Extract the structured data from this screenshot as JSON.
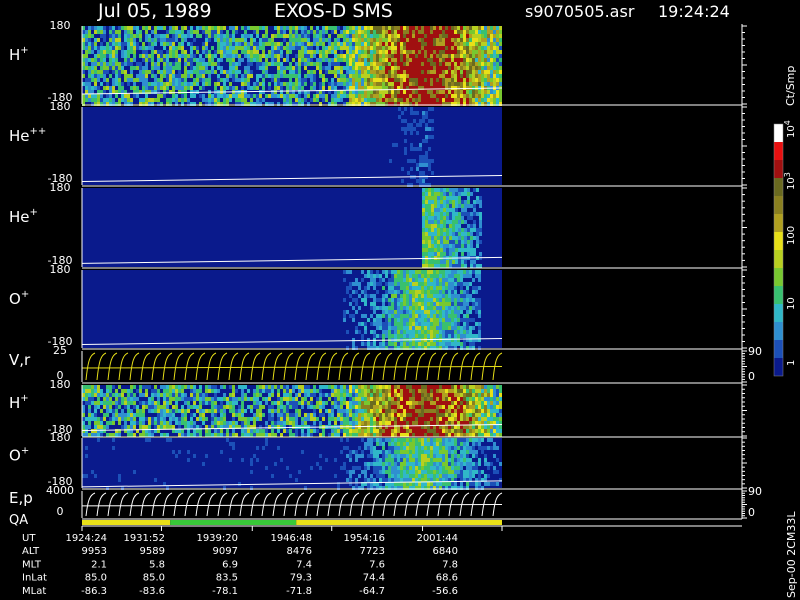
{
  "header": {
    "date": "Jul 05, 1989",
    "instrument": "EXOS-D SMS",
    "filename": "s9070505.asr",
    "time": "19:24:24"
  },
  "colorbar": {
    "unit_label": "Ct/Smp",
    "tick_labels": [
      {
        "label": "10",
        "sup": "4"
      },
      {
        "label": "10",
        "sup": "3"
      },
      {
        "label": "100",
        "sup": ""
      },
      {
        "label": "10",
        "sup": ""
      },
      {
        "label": "1",
        "sup": ""
      }
    ],
    "palette": [
      "#0a1a8c",
      "#1c50b8",
      "#2f8fd0",
      "#30b8c8",
      "#38c070",
      "#78c830",
      "#b8d020",
      "#e8e018",
      "#b0a020",
      "#8a8020",
      "#6a6a20",
      "#a01010",
      "#e81010",
      "#ffffff"
    ]
  },
  "chart_data": {
    "type": "heatmap",
    "panels": [
      {
        "id": "h-plus",
        "label": "H",
        "sup": "+",
        "ymax": "180",
        "ymin": "-180",
        "kind": "spectrogram",
        "activity_start_ut": "1924:24",
        "activity_end_ut": "2001:44",
        "intensity": "high",
        "line_level": -120
      },
      {
        "id": "he-pp",
        "label": "He",
        "sup": "++",
        "ymax": "180",
        "ymin": "-180",
        "kind": "spectrogram",
        "activity_start_ut": "1950:00",
        "activity_end_ut": "1955:00",
        "intensity": "low",
        "line_level": -150
      },
      {
        "id": "he-plus",
        "label": "He",
        "sup": "+",
        "ymax": "180",
        "ymin": "-180",
        "kind": "spectrogram",
        "activity_start_ut": "1954:00",
        "activity_end_ut": "1959:00",
        "intensity": "medium",
        "line_level": -150
      },
      {
        "id": "o-plus",
        "label": "O",
        "sup": "+",
        "ymax": "180",
        "ymin": "-180",
        "kind": "spectrogram",
        "activity_start_ut": "1947:00",
        "activity_end_ut": "1959:00",
        "intensity": "medium",
        "line_level": -150
      },
      {
        "id": "vr",
        "label": "V,r",
        "sup": "",
        "ymax": "25",
        "ymin": "0",
        "kind": "lines",
        "right_top": "90",
        "right_bottom": "0"
      },
      {
        "id": "h-plus-2",
        "label": "H",
        "sup": "+",
        "ymax": "180",
        "ymin": "-180",
        "kind": "spectrogram",
        "activity_start_ut": "1924:24",
        "activity_end_ut": "2001:44",
        "intensity": "high",
        "line_level": -120
      },
      {
        "id": "o-plus-2",
        "label": "O",
        "sup": "+",
        "ymax": "180",
        "ymin": "-180",
        "kind": "spectrogram",
        "activity_start_ut": "1924:24",
        "activity_end_ut": "2001:44",
        "intensity": "medium",
        "line_level": -150
      },
      {
        "id": "ep",
        "label": "E,p",
        "sup": "",
        "ymax": "4000",
        "ymin": "0",
        "kind": "lines",
        "right_top": "90",
        "right_bottom": "0"
      }
    ],
    "qa": {
      "label": "QA",
      "segments": [
        {
          "color": "#e8e018",
          "fraction": 0.21
        },
        {
          "color": "#38c838",
          "fraction": 0.3
        },
        {
          "color": "#e8e018",
          "fraction": 0.49
        }
      ]
    },
    "ephemeris": {
      "rows": [
        {
          "label": "UT",
          "values": [
            "1924:24",
            "1931:52",
            "1939:20",
            "1946:48",
            "1954:16",
            "2001:44"
          ]
        },
        {
          "label": "ALT",
          "values": [
            "9953",
            "9589",
            "9097",
            "8476",
            "7723",
            "6840"
          ]
        },
        {
          "label": "MLT",
          "values": [
            "2.1",
            "5.8",
            "6.9",
            "7.4",
            "7.6",
            "7.8"
          ]
        },
        {
          "label": "InLat",
          "values": [
            "85.0",
            "85.0",
            "83.5",
            "79.3",
            "74.4",
            "68.6"
          ]
        },
        {
          "label": "MLat",
          "values": [
            "-86.3",
            "-83.6",
            "-78.1",
            "-71.8",
            "-64.7",
            "-56.6"
          ]
        }
      ]
    }
  },
  "footer": {
    "code": "Sep-00 2CM33L"
  }
}
